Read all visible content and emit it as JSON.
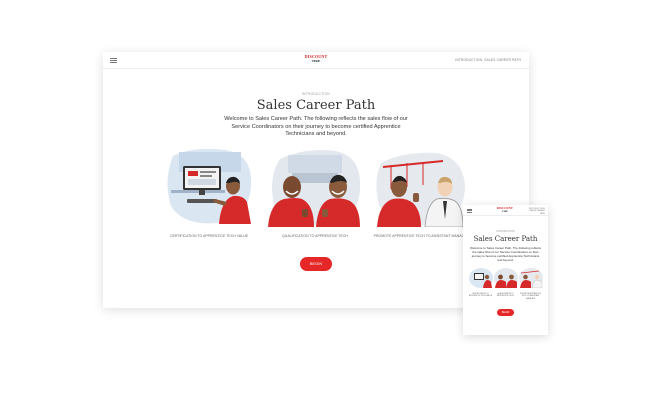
{
  "desktop": {
    "header": {
      "logo_line1": "DISCOUNT",
      "logo_line2": "TIRE",
      "course_label": "INTRODUCTION: SALES CAREER PATH"
    },
    "eyebrow": "INTRODUCTION",
    "title": "Sales Career Path",
    "intro": "Welcome to Sales Career Path. The following reflects the sales flow of our Service Coordinators on their journey to become certified Apprentice Technicians and beyond.",
    "cards": [
      {
        "caption": "CERTIFICATION TO APPRENTICE TECH VALUE"
      },
      {
        "caption": "QUALIFICATION TO APPRENTICE TECH"
      },
      {
        "caption": "PROMOTE APPRENTICE TECH TO ASSISTANT MANAG"
      }
    ],
    "button_label": "BEGIN"
  },
  "mobile": {
    "logo_line1": "DISCOUNT",
    "logo_line2": "TIRE",
    "course_label": "INTRODUCTION: SALES CAREER PATH",
    "eyebrow": "INTRODUCTION",
    "title": "Sales Career Path",
    "intro": "Welcome to Sales Career Path. The following reflects the sales flow of our Service Coordinators on their journey to become certified Apprentice Technicians and beyond.",
    "captions": [
      "CERTIFICATION TO APPRENTICE TECH VALUE",
      "QUALIFICATION TO APPRENTICE TECH",
      "PROMOTE APPRENTICE TECH TO ASSISTANT MANAGER"
    ],
    "button_label": "BEGIN"
  },
  "colors": {
    "brand_red": "#e52727",
    "logo_red": "#d21f1f",
    "shirt_red": "#d62a2a"
  }
}
